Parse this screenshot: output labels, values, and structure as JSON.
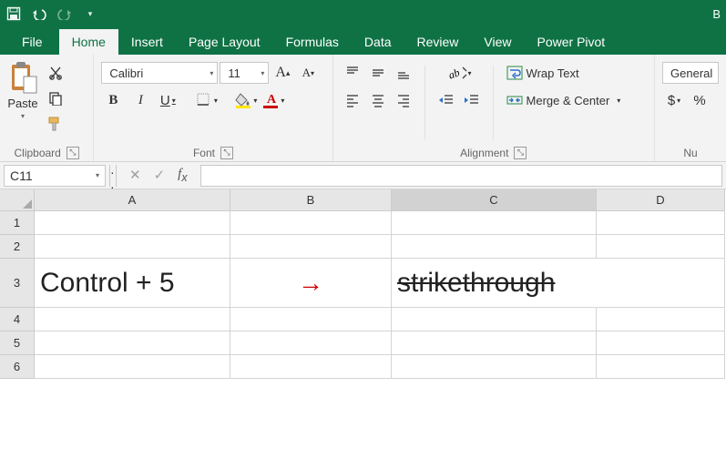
{
  "title_suffix": "B",
  "tabs": {
    "file": "File",
    "home": "Home",
    "insert": "Insert",
    "layout": "Page Layout",
    "formulas": "Formulas",
    "data": "Data",
    "review": "Review",
    "view": "View",
    "pivot": "Power Pivot"
  },
  "ribbon": {
    "clipboard": {
      "paste": "Paste",
      "label": "Clipboard"
    },
    "font": {
      "family": "Calibri",
      "size": "11",
      "bold": "B",
      "italic": "I",
      "underline": "U",
      "label": "Font"
    },
    "alignment": {
      "wrap": "Wrap Text",
      "merge": "Merge & Center",
      "label": "Alignment"
    },
    "number": {
      "format": "General",
      "currency": "$",
      "percent": "%",
      "label": "Nu"
    }
  },
  "namebox": "C11",
  "columns": [
    "A",
    "B",
    "C",
    "D"
  ],
  "rows": [
    "1",
    "2",
    "3",
    "4",
    "5",
    "6"
  ],
  "cells": {
    "A3": "Control + 5",
    "B3": "→",
    "C3": "strikethrough"
  }
}
